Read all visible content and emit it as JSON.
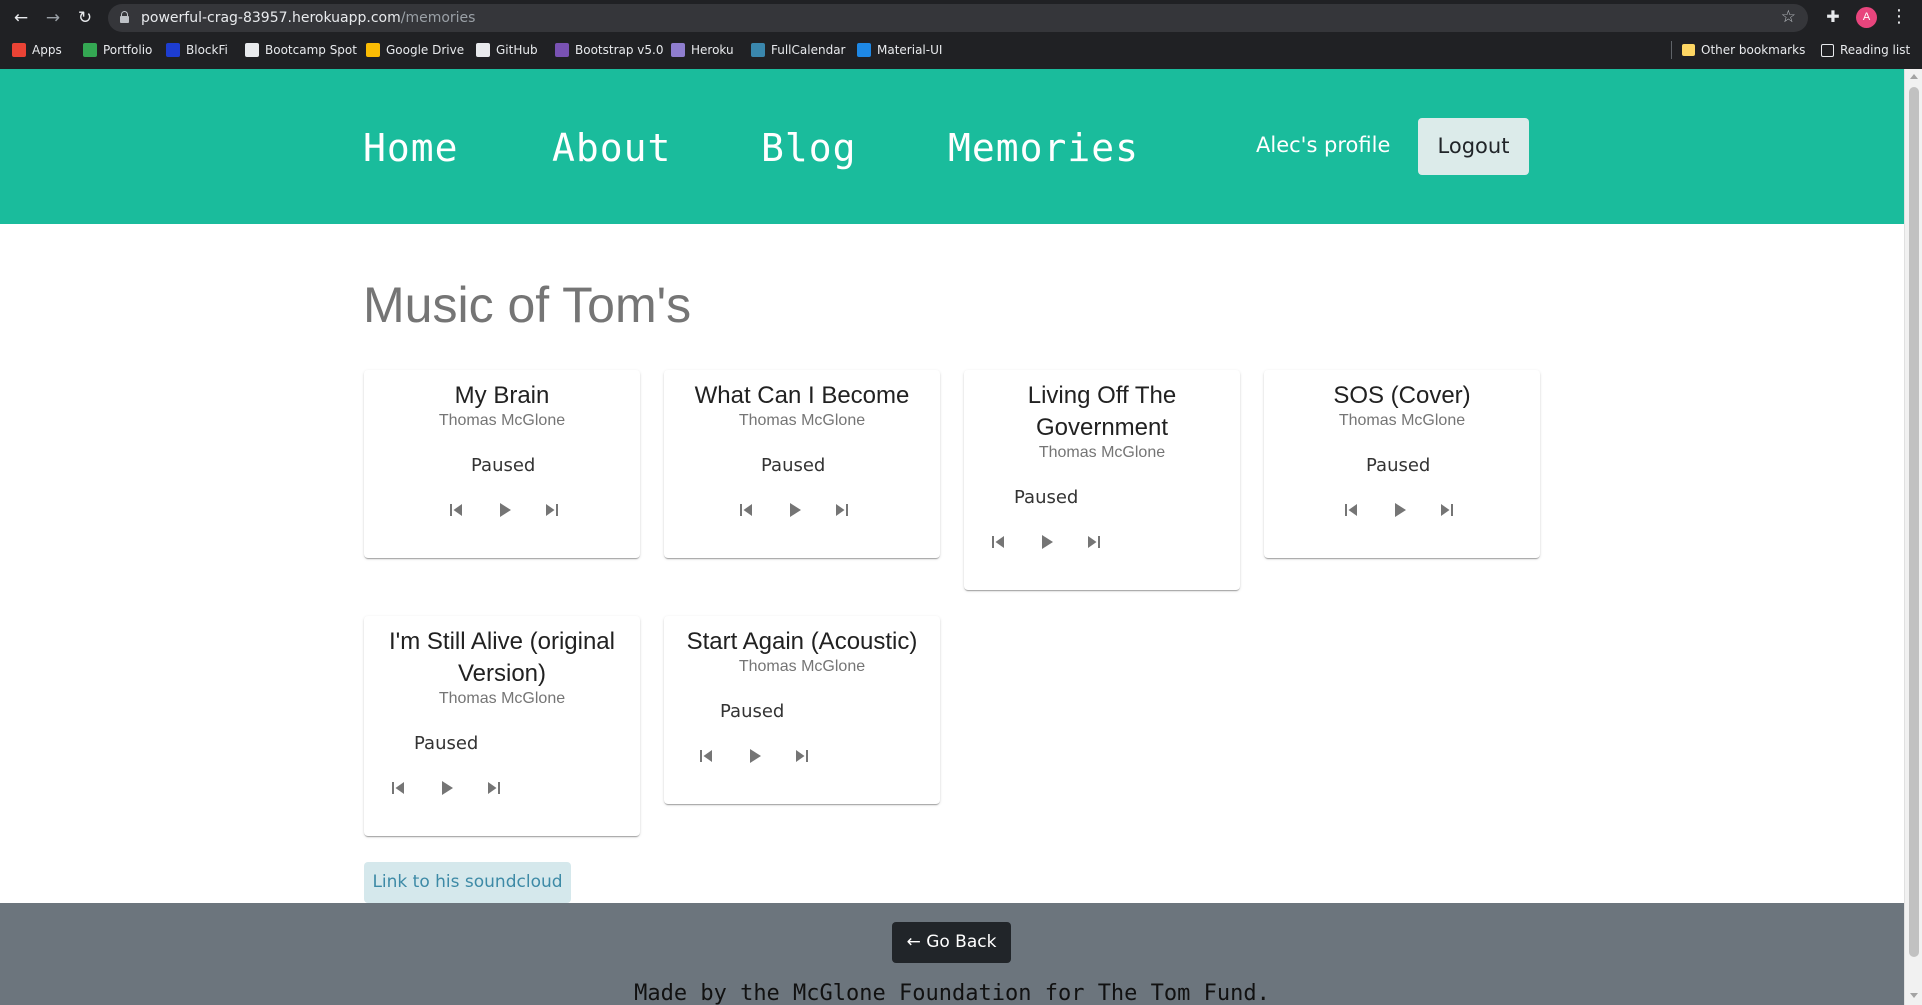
{
  "browser": {
    "url_host": "powerful-crag-83957.herokuapp.com",
    "url_path": "/memories",
    "profile_initial": "A",
    "bookmarks": [
      {
        "label": "Apps",
        "icon": "apps-grid-icon",
        "color": "#ea4335"
      },
      {
        "label": "Portfolio",
        "icon": "pencil-icon",
        "color": "#34a853"
      },
      {
        "label": "BlockFi",
        "icon": "blockfi-icon",
        "color": "#1d3dd1"
      },
      {
        "label": "Bootcamp Spot",
        "icon": "bootcamp-icon",
        "color": "#e8eaed"
      },
      {
        "label": "Google Drive",
        "icon": "drive-icon",
        "color": "#fbbc04"
      },
      {
        "label": "GitHub",
        "icon": "github-icon",
        "color": "#e8eaed"
      },
      {
        "label": "Bootstrap v5.0",
        "icon": "bootstrap-icon",
        "color": "#7952b3"
      },
      {
        "label": "Heroku",
        "icon": "heroku-icon",
        "color": "#8f7ecf"
      },
      {
        "label": "FullCalendar",
        "icon": "calendar-icon",
        "color": "#3a87ad"
      },
      {
        "label": "Material-UI",
        "icon": "material-ui-icon",
        "color": "#1e88e5"
      }
    ],
    "other_bookmarks": "Other bookmarks",
    "reading_list": "Reading list"
  },
  "header": {
    "nav": [
      "Home",
      "About",
      "Blog",
      "Memories"
    ],
    "profile_link": "Alec's profile",
    "logout": "Logout"
  },
  "main": {
    "title": "Music of Tom's",
    "tracks": [
      {
        "title": "My Brain",
        "artist": "Thomas McGlone",
        "status": "Paused"
      },
      {
        "title": "What Can I Become",
        "artist": "Thomas McGlone",
        "status": "Paused"
      },
      {
        "title": "Living Off The Government",
        "artist": "Thomas McGlone",
        "status": "Paused"
      },
      {
        "title": "SOS (Cover)",
        "artist": "Thomas McGlone",
        "status": "Paused"
      },
      {
        "title": "I'm Still Alive (original Version)",
        "artist": "Thomas McGlone",
        "status": "Paused"
      },
      {
        "title": "Start Again (Acoustic)",
        "artist": "Thomas McGlone",
        "status": "Paused"
      }
    ],
    "soundcloud_link": "Link to his soundcloud"
  },
  "footer": {
    "back_button": "← Go Back",
    "credit": "Made by the McGlone Foundation for The Tom Fund."
  },
  "colors": {
    "header_bg": "#1abc9c",
    "footer_bg": "#6c757d"
  }
}
